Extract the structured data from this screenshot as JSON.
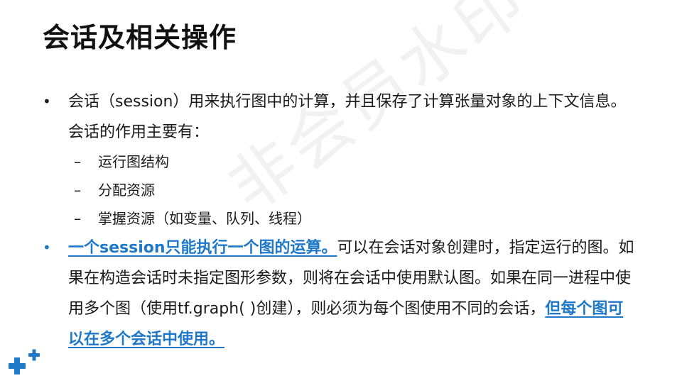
{
  "slide": {
    "title": "会话及相关操作",
    "watermark": "非会员水印",
    "bullets": [
      {
        "parts": [
          {
            "text": "会话（session）用来执行图中的计算，并且保存了计算张量对象的上下文信息。会话的作用主要有："
          }
        ],
        "subitems": [
          {
            "dash": "–",
            "text": "运行图结构"
          },
          {
            "dash": "–",
            "text": "分配资源"
          },
          {
            "dash": "–",
            "text": "掌握资源（如变量、队列、线程）"
          }
        ]
      },
      {
        "parts": [
          {
            "text": "一个session只能执行一个图的运算。",
            "highlight": true
          },
          {
            "text": "可以在会话对象创建时，指定运行的图。如果在构造会话时未指定图形参数，则将在会话中使用默认图。如果在同一进程中使用多个图（使用tf.graph( )创建），则必须为每个图使用不同的会话，"
          },
          {
            "text": "但每个图可以在多个会话中使用。",
            "highlight": true
          }
        ]
      }
    ],
    "bullet_symbol": "•",
    "colors": {
      "accent": "#1f78c8",
      "text": "#1a1a1a",
      "title": "#111111"
    },
    "logo_icon": "plus-cross-logo-icon"
  }
}
